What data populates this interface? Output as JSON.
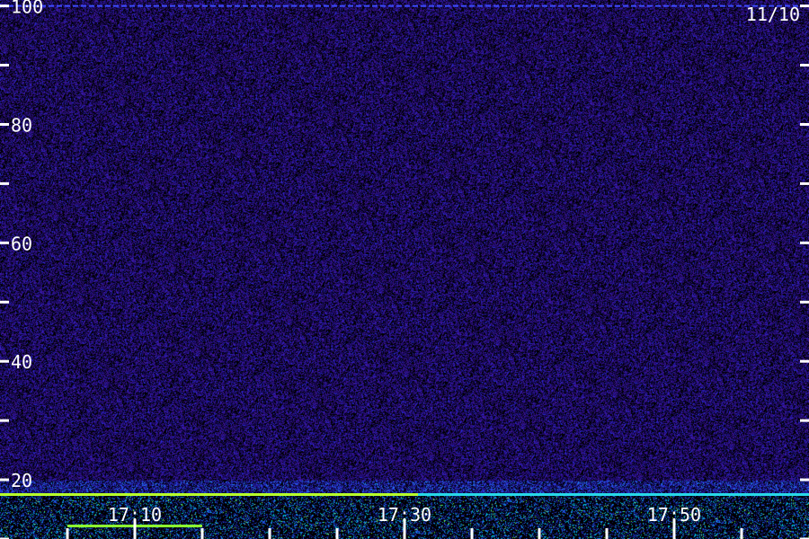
{
  "chart_data": {
    "type": "heatmap",
    "title": "",
    "xlabel": "",
    "ylabel": "",
    "date_label": "11/10",
    "x_axis": {
      "range": [
        "17:00",
        "18:00"
      ],
      "tick_labels": [
        "17:10",
        "17:30",
        "17:50"
      ],
      "major_tick_values": [
        "17:10",
        "17:30",
        "17:50"
      ],
      "minor_tick_values": [
        "17:05",
        "17:15",
        "17:20",
        "17:25",
        "17:35",
        "17:40",
        "17:45",
        "17:55"
      ]
    },
    "y_axis": {
      "range": [
        10,
        101
      ],
      "tick_labels": [
        "20",
        "40",
        "60",
        "80",
        "100"
      ],
      "tick_label_values": [
        20,
        40,
        60,
        80,
        100
      ],
      "minor_tick_values": [
        10,
        30,
        50,
        70,
        90
      ]
    },
    "colormap": [
      "#000000",
      "#1a0a55",
      "#3a1496",
      "#2a2ad8",
      "#1f6ef0",
      "#00e0e6",
      "#7cff3c",
      "#ffff00"
    ],
    "features": [
      {
        "kind": "horizontal-line",
        "y": 100,
        "x_range": [
          "17:00",
          "18:00"
        ],
        "color": "#3d4cff"
      },
      {
        "kind": "horizontal-line",
        "y": 17.5,
        "x_range": [
          "17:00",
          "17:31"
        ],
        "color": "#b8ff2a"
      },
      {
        "kind": "horizontal-line",
        "y": 17.5,
        "x_range": [
          "17:31",
          "18:00"
        ],
        "color": "#28d8e8"
      },
      {
        "kind": "horizontal-line",
        "y": 12.2,
        "x_range": [
          "17:05",
          "17:15"
        ],
        "color": "#8cff30"
      }
    ],
    "grid": false,
    "legend": "none"
  }
}
